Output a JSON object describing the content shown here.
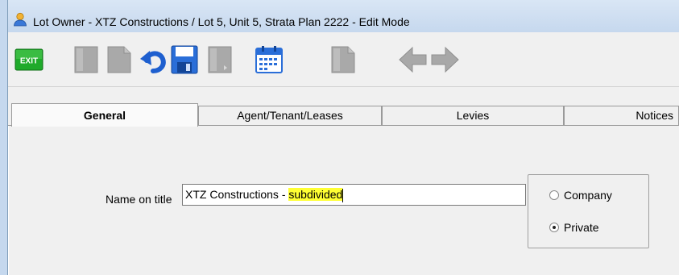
{
  "window": {
    "title": "Lot Owner - XTZ Constructions / Lot 5, Unit 5, Strata Plan 2222 - Edit Mode"
  },
  "toolbar": {
    "buttons": [
      {
        "name": "exit-button",
        "label": "EXIT",
        "icon": "exit-icon",
        "enabled": true
      },
      {
        "name": "new-button",
        "icon": "document-icon",
        "enabled": false
      },
      {
        "name": "copy-button",
        "icon": "document-icon",
        "enabled": false
      },
      {
        "name": "undo-button",
        "icon": "undo-icon",
        "enabled": true
      },
      {
        "name": "save-button",
        "icon": "floppy-disk-icon",
        "enabled": true
      },
      {
        "name": "print-button",
        "icon": "document-icon",
        "enabled": false
      },
      {
        "name": "calendar-button",
        "icon": "calendar-icon",
        "enabled": true
      },
      {
        "name": "attach-button",
        "icon": "document-icon",
        "enabled": false
      },
      {
        "name": "previous-button",
        "icon": "arrow-left-icon",
        "enabled": false
      },
      {
        "name": "next-button",
        "icon": "arrow-right-icon",
        "enabled": false
      }
    ]
  },
  "tabs": [
    {
      "label": "General",
      "active": true
    },
    {
      "label": "Agent/Tenant/Leases",
      "active": false
    },
    {
      "label": "Levies",
      "active": false
    },
    {
      "label": "Notices",
      "active": false
    }
  ],
  "general": {
    "name_label": "Name on title",
    "name_value_prefix": "XTZ Constructions - ",
    "name_value_highlight": "subdivided",
    "owner_type": {
      "options": [
        {
          "label": "Company",
          "checked": false
        },
        {
          "label": "Private",
          "checked": true
        }
      ]
    }
  },
  "colors": {
    "highlight": "#ffff33",
    "titlebar": "#c6d8ee",
    "exit_green": "#1faa2a",
    "icon_blue": "#2a6ed8",
    "disabled_gray": "#a8a8a8"
  }
}
